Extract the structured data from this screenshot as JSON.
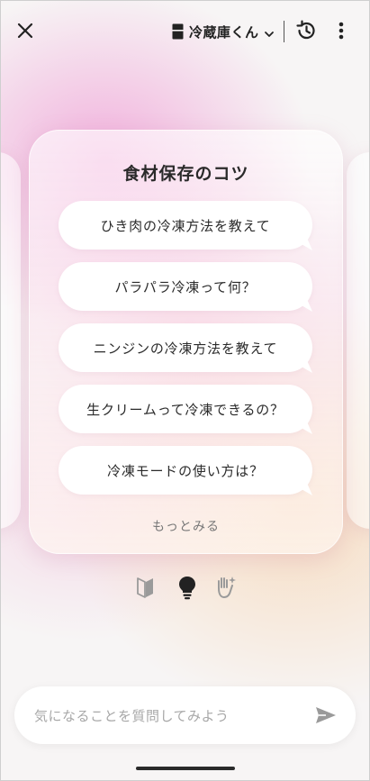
{
  "header": {
    "device_name": "冷蔵庫くん"
  },
  "card": {
    "title": "食材保存のコツ",
    "suggestions": [
      "ひき肉の冷凍方法を教えて",
      "パラパラ冷凍って何？",
      "ニンジンの冷凍方法を教えて",
      "生クリームって冷凍できるの？",
      "冷凍モードの使い方は？"
    ],
    "more_label": "もっとみる"
  },
  "tabs": {
    "icons": [
      "beginner-mark-icon",
      "lightbulb-icon",
      "sparkle-hand-icon"
    ],
    "active_index": 1
  },
  "composer": {
    "placeholder": "気になることを質問してみよう",
    "value": ""
  },
  "colors": {
    "card_text": "#2b2b2b",
    "muted": "#777777",
    "placeholder": "#a8a8a8",
    "inactive_tab_icon": "#9a9a9a",
    "active_tab_icon": "#222222"
  }
}
